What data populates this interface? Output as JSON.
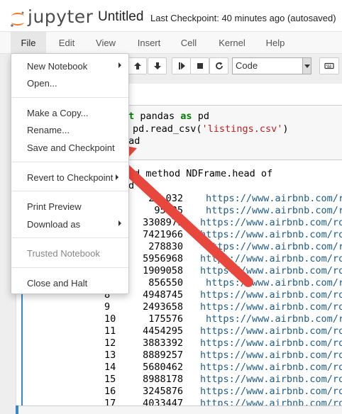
{
  "header": {
    "logo_text": "jupyter",
    "notebook_title": "Untitled",
    "checkpoint_text": "Last Checkpoint: 40 minutes ago (autosaved)"
  },
  "menubar": {
    "items": [
      "File",
      "Edit",
      "View",
      "Insert",
      "Cell",
      "Kernel",
      "Help"
    ]
  },
  "toolbar": {
    "cell_type": "Code",
    "icons": [
      "arrow-up-icon",
      "arrow-down-icon",
      "step-forward-icon",
      "stop-icon",
      "restart-icon",
      "keyboard-icon"
    ]
  },
  "file_menu": {
    "items": [
      {
        "label": "New Notebook",
        "submenu": true
      },
      {
        "label": "Open...",
        "submenu": false
      },
      {
        "label": "Make a Copy...",
        "submenu": false
      },
      {
        "label": "Rename...",
        "submenu": false
      },
      {
        "label": "Save and Checkpoint",
        "submenu": false
      },
      {
        "label": "Revert to Checkpoint",
        "submenu": true
      },
      {
        "label": "Print Preview",
        "submenu": false
      },
      {
        "label": "Download as",
        "submenu": true
      },
      {
        "label": "Trusted Notebook",
        "submenu": false,
        "disabled": true
      },
      {
        "label": "Close and Halt",
        "submenu": false
      }
    ]
  },
  "code_cell": {
    "line1_kw": "rt",
    "line1_a": " pandas ",
    "line1_kw2": "as",
    "line1_b": " pd",
    "line2_a": "pd.read_csv(",
    "line2_str": "'listings.csv'",
    "line2_b": ")",
    "line3": "ead"
  },
  "output": {
    "header_line": "nd method NDFrame.head of",
    "header_line2": "d  \\",
    "ids": [
      "24 032",
      "95335",
      "3308979",
      "7421966",
      "278830",
      "5956968",
      "1909058",
      "856550",
      "4948745",
      "2493658",
      "175576",
      "4454295",
      "3883392",
      "8889257",
      "5680462",
      "8988178",
      "3245876",
      "4033447"
    ],
    "row_indices": [
      "8",
      "9",
      "10",
      "11",
      "12",
      "13",
      "14",
      "15",
      "16",
      "17"
    ],
    "urls": [
      "https://www.airbnb.com/r",
      "https://www.airbnb.com/r",
      "https://www.airbnb.com/ro",
      "https://www.airbnb.com/ro",
      "https://www.airbnb.com/r",
      "https://www.airbnb.com/ro",
      "https://www.airbnb.com/ro",
      "https://www.airbnb.com/r",
      "https://www.airbnb.com/ro",
      "https://www.airbnb.com/ro",
      "https://www.airbnb.com/r",
      "https://www.airbnb.com/ro",
      "https://www.airbnb.com/ro",
      "https://www.airbnb.com/ro",
      "https://www.airbnb.com/ro",
      "https://www.airbnb.com/ro",
      "https://www.airbnb.com/ro",
      "https://www.airbnb.com/ro"
    ]
  },
  "colors": {
    "annotation_arrow": "#e8473d",
    "jupyter_orange": "#f37726",
    "selected_cell_bar": "#3a87c8"
  }
}
